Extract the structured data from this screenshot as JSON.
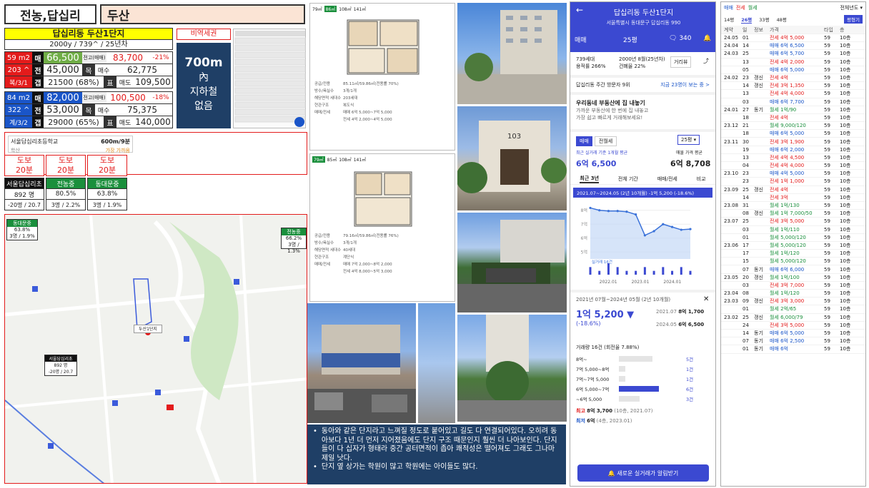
{
  "header": {
    "region": "전농,답십리",
    "complex": "두산"
  },
  "info": {
    "title": "답십리동 두산1단지",
    "subtitle": "2000y / 739^ / 25년차",
    "ratio_label": "비역세권",
    "station_big": "700m",
    "station_txt1": "內",
    "station_txt2": "지하철",
    "station_txt3": "없음"
  },
  "unit1": {
    "size": "59 m2",
    "households": "203 ^",
    "floor": "복/3/1",
    "sale_lbl": "매",
    "sale": "66,500",
    "jeon_lbl": "전",
    "jeon": "45,000",
    "gap_lbl": "갭",
    "gap": "21500 (68%)",
    "peak_lbl": "전고(매매)",
    "peak": "83,700",
    "peak_pct": "-21%",
    "goal_lbl": "목",
    "buy_lbl": "매수",
    "buy": "62,775",
    "target_lbl": "표",
    "sell_lbl": "매도",
    "sell": "109,500"
  },
  "unit2": {
    "size": "84 m2",
    "households": "322 ^",
    "floor": "계/3/2",
    "sale_lbl": "매",
    "sale": "82,000",
    "jeon_lbl": "전",
    "jeon": "53,000",
    "gap_lbl": "갭",
    "gap": "29000 (65%)",
    "peak_lbl": "전고(매매)",
    "peak": "100,500",
    "peak_pct": "-18%",
    "goal_lbl": "목",
    "buy_lbl": "매수",
    "buy": "75,375",
    "target_lbl": "표",
    "sell_lbl": "매도",
    "sell": "140,000"
  },
  "school": {
    "name": "서울답십리초등학교",
    "dist": "600m/9분",
    "sub": "학산",
    "sub2": "가장 가까움"
  },
  "walk": [
    "도보\n20분",
    "도보\n20분",
    "도보\n20분"
  ],
  "schools": [
    {
      "name": "서울답십리초",
      "v1": "892 명",
      "v2": "-20명 / 20.7"
    },
    {
      "name": "전농중",
      "v1": "80.5%",
      "v2": "3명 / 2.2%"
    },
    {
      "name": "동대문중",
      "v1": "63.8%",
      "v2": "3명 / 1.9%"
    }
  ],
  "map": {
    "label1": "동대문중",
    "label1_v1": "63.8%",
    "label1_v2": "3명 / 1.9%",
    "label2": "전농중",
    "label2_v1": "66.2%",
    "label2_v2": "3명 / 1.3%",
    "label3": "서울답십리초",
    "label3_v1": "892 명",
    "label3_v2": "-20명 / 20.7",
    "marker": "두산1단지"
  },
  "floorplan1": {
    "tabs": [
      "79㎡",
      "86㎡",
      "108㎡",
      "141㎡"
    ],
    "rows": [
      [
        "공급/전용",
        "85.11㎡/59.86㎡(전용률 70%)"
      ],
      [
        "방수/욕실수",
        "3개/1개"
      ],
      [
        "해당면적 세대수",
        "203세대"
      ],
      [
        "현관구조",
        "복도식"
      ],
      [
        "매매/전세",
        "매매 6억 5,000~7억 5,000"
      ],
      [
        "",
        "전세 4억 2,000~4억 5,000"
      ]
    ]
  },
  "floorplan2": {
    "tabs": [
      "79㎡",
      "85㎡",
      "108㎡",
      "141㎡"
    ],
    "rows": [
      [
        "공급/전용",
        "79.16㎡/59.86㎡(전용률 76%)"
      ],
      [
        "방수/욕실수",
        "3개/1개"
      ],
      [
        "해당면적 세대수",
        "40세대"
      ],
      [
        "현관구조",
        "계단식"
      ],
      [
        "매매/전세",
        "매매 7억 2,000~8억 2,000"
      ],
      [
        "",
        "전세 4억 8,000~5억 3,000"
      ]
    ]
  },
  "comments": [
    "동아와 같은 단지라고 느껴질 정도로 붙어있고 길도 다 연결되어있다. 오히려 동아보다 1년 더 먼저 지어졌음에도 단지 구조 때문인지 훨씬 더 나아보인다. 단지들이 다 십자가 형태라 중간 공터면적이 좁아 쾌적성은 떨어져도 그래도 그나마 제일 낫다.",
    "단지 옆 상가는 학원이 많고 학원에는 아이들도 많다."
  ],
  "app": {
    "title": "답십리동 두산1단지",
    "address": "서울특별시 동대문구 답십리동 990",
    "tab_sale": "매매",
    "size_sel": "25평",
    "comments": "340",
    "households": "739세대",
    "built": "2000년 8월(25년차)",
    "floor_ratio": "용적률 266%",
    "build_ratio": "건폐율 22%",
    "dist_btn": "거리뷰",
    "visitors": "답십리동 주간 방문자 9위",
    "visitors_link": "지금 23명이 보는 중 >",
    "ad_title": "우리동네 부동산에 집 내놓기",
    "ad_sub1": "가까운 부동산에 한 번에 집 내놓고",
    "ad_sub2": "가장 쉽고 빠르게 거래해보세요!",
    "tab_m": "매매",
    "tab_j": "전월세",
    "size": "25평",
    "recent_label": "최근 실거래 기준 1개월 평균",
    "recent": "6억 6,500",
    "ask_label": "매물 가격 평균",
    "ask": "6억 8,708",
    "periods": [
      "최근 3년",
      "전체 기간",
      "매매/전세",
      "비교"
    ],
    "range_text": "2021.07~2024.05 (2년 10개월)  -1억 5,200 (-18.6%)",
    "xticks": [
      "2022.01",
      "2023.01",
      "2024.01"
    ],
    "yticks": [
      "8억",
      "7억",
      "6억",
      "5억"
    ],
    "period2": "2021년 07월~2024년 05월 (2년 10개월)",
    "drop": "1억 5,200 ▼",
    "drop_pct": "(-18.6%)",
    "hi_date": "2021.07",
    "hi": "8억 1,700",
    "lo_date": "2024.05",
    "lo": "6억 6,500",
    "trades": "거래량 16건 (회전율 7.88%)",
    "dist_rows": [
      {
        "lbl": "8억~",
        "cnt": "5건",
        "w": 0.52
      },
      {
        "lbl": "7억 5,000~8억",
        "cnt": "1건",
        "w": 0.1
      },
      {
        "lbl": "7억~7억 5,000",
        "cnt": "1건",
        "w": 0.1
      },
      {
        "lbl": "6억 5,000~7억",
        "cnt": "6건",
        "w": 0.62
      },
      {
        "lbl": "~6억 5,000",
        "cnt": "3건",
        "w": 0.32
      }
    ],
    "max_lbl": "최고",
    "max": "8억 3,700",
    "max_date": "(10층, 2021.07)",
    "min_lbl": "최저",
    "min": "6억",
    "min_date": "(4층, 2023.01)",
    "alert_btn": "새로운 실거래가 알림받기"
  },
  "tx": {
    "tabs": [
      "매매",
      "전세",
      "월세"
    ],
    "year": "전체년도",
    "sizes": [
      "14평",
      "26평",
      "33평",
      "48평"
    ],
    "btn": "평형기",
    "cols": [
      "계약",
      "일",
      "정보",
      "가격",
      "타입",
      "층"
    ],
    "rows": [
      [
        "24.05",
        "01",
        "",
        "전세 4억 5,000",
        "59",
        "10층"
      ],
      [
        "24.04",
        "14",
        "",
        "매매 6억 6,500",
        "59",
        "10층"
      ],
      [
        "24.03",
        "25",
        "",
        "매매 6억 5,700",
        "59",
        "10층"
      ],
      [
        "",
        "13",
        "",
        "전세 4억 2,000",
        "59",
        "10층"
      ],
      [
        "",
        "05",
        "",
        "매매 6억 5,000",
        "59",
        "10층"
      ],
      [
        "24.02",
        "23",
        "갱신",
        "전세 4억",
        "59",
        "10층"
      ],
      [
        "",
        "14",
        "갱신",
        "전세 3억 1,350",
        "59",
        "10층"
      ],
      [
        "",
        "13",
        "",
        "전세 4억 4,000",
        "59",
        "10층"
      ],
      [
        "",
        "03",
        "",
        "매매 6억 7,700",
        "59",
        "10층"
      ],
      [
        "24.01",
        "27",
        "동기",
        "월세 1억/90",
        "59",
        "10층"
      ],
      [
        "",
        "18",
        "",
        "전세 4억",
        "59",
        "10층"
      ],
      [
        "23.12",
        "21",
        "",
        "월세 9,000/120",
        "59",
        "10층"
      ],
      [
        "",
        "18",
        "",
        "매매 6억 5,000",
        "59",
        "10층"
      ],
      [
        "23.11",
        "30",
        "",
        "전세 3억 1,900",
        "59",
        "10층"
      ],
      [
        "",
        "19",
        "",
        "매매 6억 2,000",
        "59",
        "10층"
      ],
      [
        "",
        "13",
        "",
        "전세 4억 4,500",
        "59",
        "10층"
      ],
      [
        "",
        "04",
        "",
        "전세 4억 4,000",
        "59",
        "10층"
      ],
      [
        "23.10",
        "23",
        "",
        "매매 4억 5,000",
        "59",
        "10층"
      ],
      [
        "",
        "23",
        "",
        "전세 1억 1,000",
        "59",
        "10층"
      ],
      [
        "23.09",
        "25",
        "갱신",
        "전세 4억",
        "59",
        "10층"
      ],
      [
        "",
        "14",
        "",
        "전세 3억",
        "59",
        "10층"
      ],
      [
        "23.08",
        "31",
        "",
        "월세 1억/130",
        "59",
        "10층"
      ],
      [
        "",
        "08",
        "갱신",
        "월세 1억 7,000/50",
        "59",
        "10층"
      ],
      [
        "23.07",
        "25",
        "",
        "전세 3억 5,000",
        "59",
        "10층"
      ],
      [
        "",
        "03",
        "",
        "월세 1억/110",
        "59",
        "10층"
      ],
      [
        "",
        "01",
        "",
        "월세 5,000/120",
        "59",
        "10층"
      ],
      [
        "23.06",
        "17",
        "",
        "월세 5,000/120",
        "59",
        "10층"
      ],
      [
        "",
        "17",
        "",
        "월세 1억/120",
        "59",
        "10층"
      ],
      [
        "",
        "15",
        "",
        "월세 5,000/120",
        "59",
        "10층"
      ],
      [
        "",
        "07",
        "동기",
        "매매 6억 6,000",
        "59",
        "10층"
      ],
      [
        "23.05",
        "20",
        "갱신",
        "월세 1억/100",
        "59",
        "10층"
      ],
      [
        "",
        "03",
        "",
        "전세 3억 7,000",
        "59",
        "10층"
      ],
      [
        "23.04",
        "08",
        "",
        "월세 1억/120",
        "59",
        "10층"
      ],
      [
        "23.03",
        "09",
        "갱신",
        "전세 3억 3,000",
        "59",
        "10층"
      ],
      [
        "",
        "01",
        "",
        "월세 2억/65",
        "59",
        "10층"
      ],
      [
        "23.02",
        "25",
        "갱신",
        "월세 6,000/79",
        "59",
        "10층"
      ],
      [
        "",
        "24",
        "",
        "전세 3억 5,000",
        "59",
        "10층"
      ],
      [
        "",
        "14",
        "동기",
        "매매 6억 5,000",
        "59",
        "10층"
      ],
      [
        "",
        "07",
        "동기",
        "매매 6억 2,500",
        "59",
        "10층"
      ],
      [
        "",
        "01",
        "동기",
        "매매 6억",
        "59",
        "10층"
      ]
    ]
  },
  "chart_data": {
    "type": "line",
    "title": "",
    "xlabel": "",
    "ylabel": "",
    "x": [
      "2021.07",
      "2021.10",
      "2022.01",
      "2022.04",
      "2022.07",
      "2022.10",
      "2023.01",
      "2023.04",
      "2023.07",
      "2023.10",
      "2024.01",
      "2024.05"
    ],
    "series": [
      {
        "name": "실거래 16건",
        "values": [
          8.17,
          8.0,
          7.95,
          7.95,
          7.9,
          7.7,
          6.2,
          6.5,
          7.0,
          6.8,
          6.6,
          6.65
        ]
      }
    ],
    "ylim": [
      4.5,
      8.5
    ],
    "volume": [
      2,
      1,
      3,
      2,
      1,
      1,
      2,
      1,
      2,
      1,
      2,
      1
    ]
  }
}
